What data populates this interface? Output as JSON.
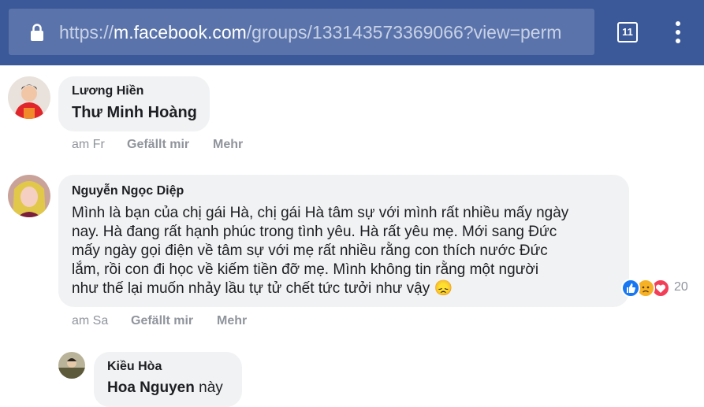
{
  "browser": {
    "url_prefix": "https://",
    "url_host": "m.facebook.com",
    "url_path": "/groups/1331435733​69066?view=perm",
    "tab_count": "11"
  },
  "comments": [
    {
      "author": "Lương Hiền",
      "text": "Thư Minh Hoàng",
      "time": "am Fr",
      "like_label": "Gefällt mir",
      "more_label": "Mehr"
    },
    {
      "author": "Nguyễn Ngọc Diệp",
      "lines": [
        "Mình là bạn của chị gái Hà, chị gái Hà tâm sự với mình rất nhiều mấy ngày",
        "nay. Hà đang rất hạnh phúc trong tình yêu. Hà rất yêu mẹ. Mới sang Đức",
        "mấy ngày gọi điện về tâm sự với mẹ rất nhiều rằng con thích nước Đức",
        "lắm, rồi con đi học về kiếm tiền đỡ mẹ. Mình không tin rằng một người",
        "như thế lại muốn nhảy lầu tự tử chết tức tưởi như vậy"
      ],
      "emoji": "😞",
      "reaction_count": "20",
      "time": "am Sa",
      "like_label": "Gefällt mir",
      "more_label": "Mehr"
    },
    {
      "author": "Kiều Hòa",
      "tag": "Hoa Nguyen",
      "text_suffix": " này"
    }
  ],
  "colors": {
    "header": "#3b5998",
    "bubble": "#f1f2f4",
    "like": "#1877f2",
    "sad": "#f7b125",
    "love": "#f33e58"
  }
}
